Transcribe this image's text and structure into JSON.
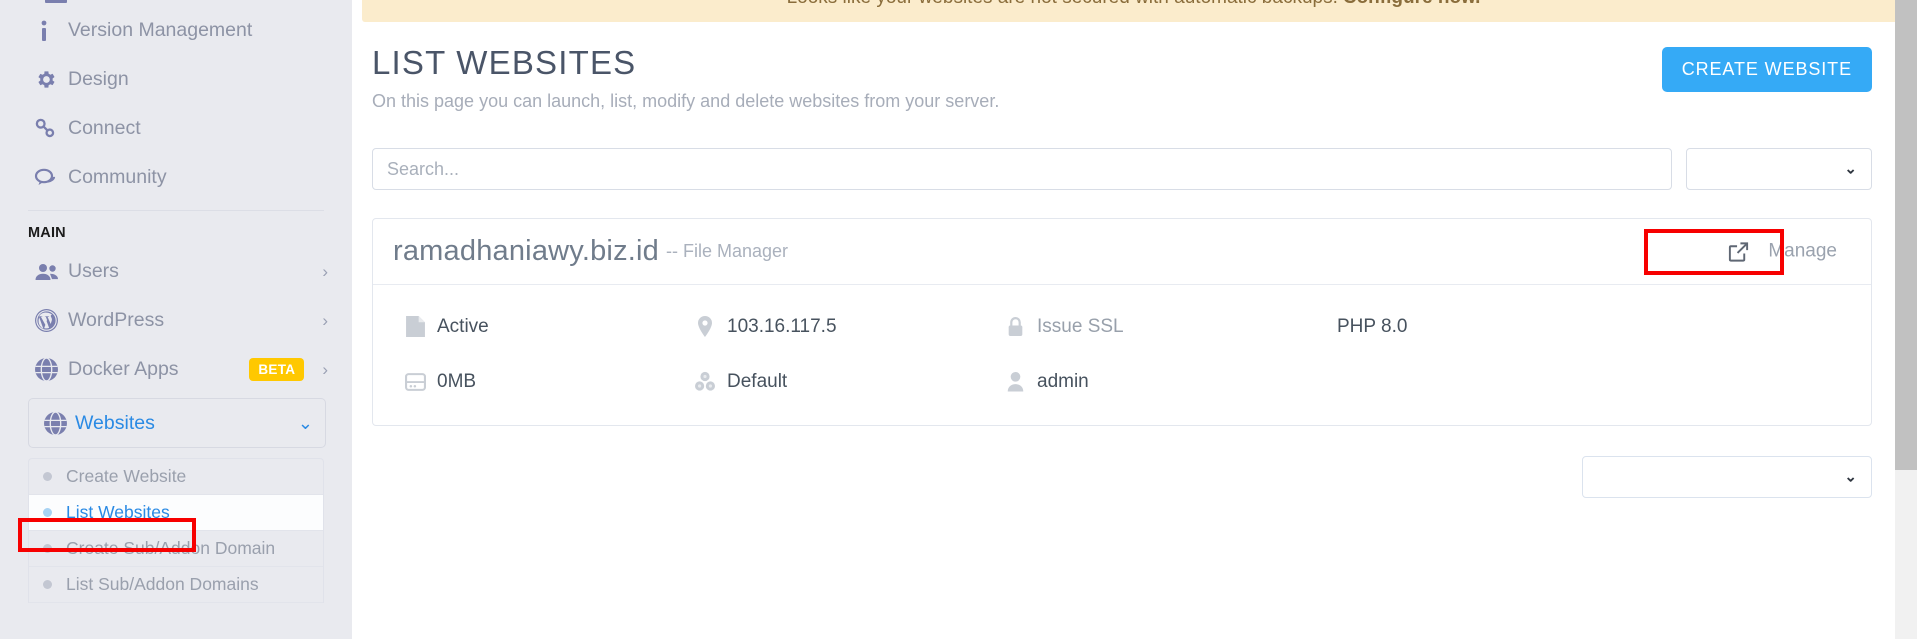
{
  "sidebar": {
    "items": [
      {
        "label": "Version Management",
        "icon": "info-icon",
        "chevron": false
      },
      {
        "label": "Design",
        "icon": "gear-icon",
        "chevron": false
      },
      {
        "label": "Connect",
        "icon": "link-icon",
        "chevron": false
      },
      {
        "label": "Community",
        "icon": "chat-icon",
        "chevron": false
      }
    ],
    "section_label": "MAIN",
    "main_items": [
      {
        "label": "Users",
        "icon": "users-icon",
        "chevron": true,
        "badge": ""
      },
      {
        "label": "WordPress",
        "icon": "wordpress-icon",
        "chevron": true,
        "badge": ""
      },
      {
        "label": "Docker Apps",
        "icon": "globe-icon",
        "chevron": true,
        "badge": "BETA"
      }
    ],
    "active_parent": {
      "label": "Websites",
      "icon": "globe-icon",
      "chevron_dir": "down"
    },
    "submenu": [
      {
        "label": "Create Website",
        "active": false
      },
      {
        "label": "List Websites",
        "active": true
      },
      {
        "label": "Create Sub/Addon Domain",
        "active": false
      },
      {
        "label": "List Sub/Addon Domains",
        "active": false
      }
    ]
  },
  "alert": {
    "text": "Looks like your websites are not secured with automatic backups.",
    "link": "Configure now."
  },
  "page": {
    "title": "LIST WEBSITES",
    "subtitle": "On this page you can launch, list, modify and delete websites from your server.",
    "create_button": "CREATE WEBSITE"
  },
  "filters": {
    "search_placeholder": "Search...",
    "search_value": "",
    "dropdown_value": ""
  },
  "website": {
    "domain": "ramadhaniawy.biz.id",
    "file_manager": "-- File Manager",
    "manage_button": "Manage",
    "details": [
      {
        "icon": "page-icon",
        "value": "Active",
        "muted": false
      },
      {
        "icon": "location-pin-icon",
        "value": "103.16.117.5",
        "muted": false
      },
      {
        "icon": "lock-icon",
        "value": "Issue SSL",
        "muted": true
      },
      {
        "icon": "none",
        "value": "PHP 8.0",
        "muted": false
      },
      {
        "icon": "disk-icon",
        "value": "0MB",
        "muted": false
      },
      {
        "icon": "package-icon",
        "value": "Default",
        "muted": false
      },
      {
        "icon": "user-icon",
        "value": "admin",
        "muted": false
      },
      {
        "icon": "none",
        "value": "",
        "muted": false
      }
    ]
  },
  "pagination": {
    "dropdown_value": ""
  },
  "colors": {
    "accent": "#35aaf6",
    "sidebar_bg": "#e9eaef",
    "alert_bg": "#fbeccc",
    "badge_beta": "#ffc800",
    "highlight": "#f70000"
  }
}
